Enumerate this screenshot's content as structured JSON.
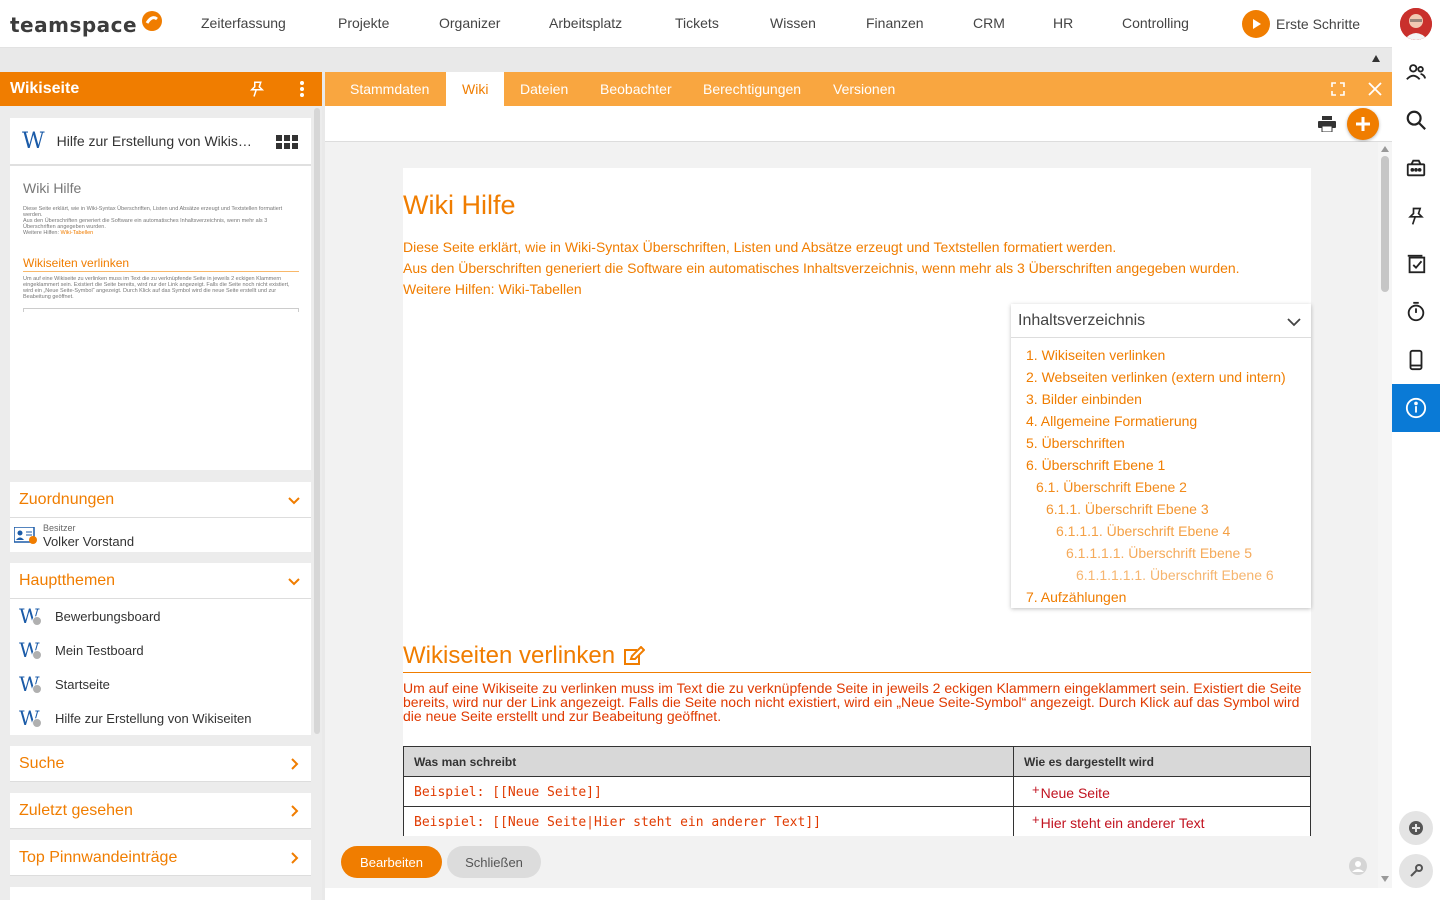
{
  "app": {
    "logo_text": "teamspace",
    "brand_color": "#f07d00",
    "tab_bar_color": "#f9a640",
    "info_active_color": "#0a7ad6"
  },
  "topnav": {
    "items": [
      "Zeiterfassung",
      "Projekte",
      "Organizer",
      "Arbeitsplatz",
      "Tickets",
      "Wissen",
      "Finanzen",
      "CRM",
      "HR",
      "Controlling"
    ],
    "erste_schritte": "Erste Schritte"
  },
  "rightbar": {
    "icons": [
      "people-icon",
      "search-icon",
      "inbox-icon",
      "pin-icon",
      "tasks-icon",
      "timer-icon",
      "mobile-icon",
      "info-icon",
      "add-circle-icon",
      "wrench-icon"
    ],
    "active": "info-icon"
  },
  "leftpanel": {
    "title": "Wikiseite",
    "preview": {
      "logo": "W",
      "title": "Hilfe zur Erstellung von Wikiseiten",
      "heading": "Wiki Hilfe",
      "line1": "Diese Seite erklärt, wie in Wiki-Syntax Überschriften, Listen und Absätze erzeugt und Textstellen formatiert werden.",
      "line2": "Aus den Überschriften generiert die Software ein automatisches Inhaltsverzeichnis, wenn mehr als 3 Überschriften angegeben wurden.",
      "line3_prefix": "Weitere Hilfen:",
      "line3_link": "Wiki-Tabellen",
      "subheading": "Wikiseiten verlinken",
      "subtext": "Um auf eine Wikiseite zu verlinken muss im Text die zu verknüpfende Seite in jeweils 2 eckigen Klammern eingeklammert sein. Existiert die Seite bereits, wird nur der Link angezeigt. Falls die Seite noch nicht existiert, wird ein „Neue Seite-Symbol“ angezeigt. Durch Klick auf das Symbol wird die neue Seite erstellt und zur Beabeitung geöffnet."
    },
    "zuordnungen": {
      "title": "Zuordnungen",
      "owner_label": "Besitzer",
      "owner_name": "Volker Vorstand"
    },
    "hauptthemen": {
      "title": "Hauptthemen",
      "items": [
        "Bewerbungsboard",
        "Mein Testboard",
        "Startseite",
        "Hilfe zur Erstellung von Wikiseiten"
      ]
    },
    "suche": "Suche",
    "zuletzt": "Zuletzt gesehen",
    "top_pinnwand": "Top Pinnwandeinträge"
  },
  "tabs": [
    "Stammdaten",
    "Wiki",
    "Dateien",
    "Beobachter",
    "Berechtigungen",
    "Versionen"
  ],
  "active_tab": "Wiki",
  "wiki": {
    "title": "Wiki Hilfe",
    "intro1": "Diese Seite erklärt, wie in Wiki-Syntax Überschriften, Listen und Absätze erzeugt und Textstellen formatiert werden.",
    "intro2": "Aus den Überschriften generiert die Software ein automatisches Inhaltsverzeichnis, wenn mehr als 3 Überschriften angegeben wurden.",
    "intro3": "Weitere Hilfen: Wiki-Tabellen",
    "toc": {
      "title": "Inhaltsverzeichnis",
      "items": [
        "1. Wikiseiten verlinken",
        "2. Webseiten verlinken (extern und intern)",
        "3. Bilder einbinden",
        "4. Allgemeine Formatierung",
        "5. Überschriften",
        "6. Überschrift Ebene 1",
        "6.1. Überschrift Ebene 2",
        "6.1.1. Überschrift Ebene 3",
        "6.1.1.1. Überschrift Ebene 4",
        "6.1.1.1.1. Überschrift Ebene 5",
        "6.1.1.1.1.1. Überschrift Ebene 6",
        "7. Aufzählungen"
      ]
    },
    "section1": {
      "title": "Wikiseiten verlinken",
      "body": "Um auf eine Wikiseite zu verlinken muss im Text die zu verknüpfende Seite in jeweils 2 eckigen Klammern eingeklammert sein. Existiert die Seite bereits, wird nur der Link angezeigt. Falls die Seite noch nicht existiert, wird ein „Neue Seite-Symbol“ angezeigt. Durch Klick auf das Symbol wird die neue Seite erstellt und zur Beabeitung geöffnet.",
      "table": {
        "headers": [
          "Was man schreibt",
          "Wie es dargestellt wird"
        ],
        "rows": [
          [
            "Beispiel: [[Neue Seite]]",
            "Neue Seite"
          ],
          [
            "Beispiel: [[Neue Seite|Hier steht ein anderer Text]]",
            "Hier steht ein anderer Text"
          ]
        ]
      }
    }
  },
  "footer": {
    "edit": "Bearbeiten",
    "close": "Schließen"
  }
}
